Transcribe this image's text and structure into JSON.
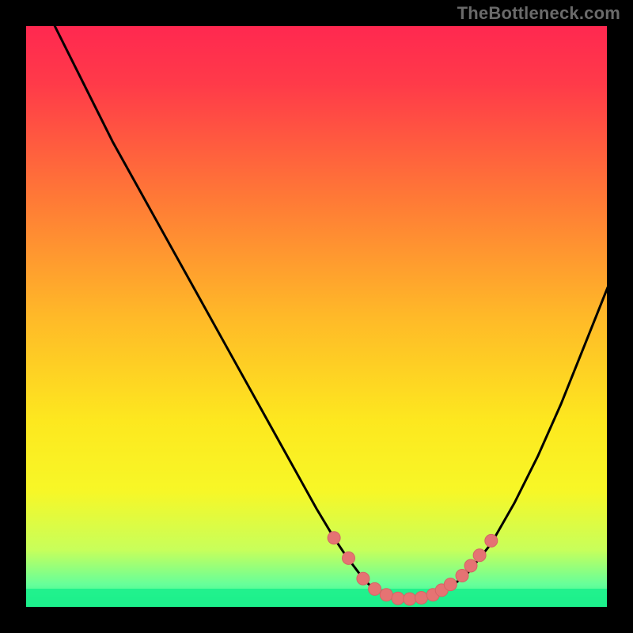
{
  "watermark": "TheBottleneck.com",
  "colors": {
    "background": "#000000",
    "gradient_stops": [
      {
        "offset": 0.0,
        "color": "#ff2850"
      },
      {
        "offset": 0.1,
        "color": "#ff3a49"
      },
      {
        "offset": 0.3,
        "color": "#ff7a36"
      },
      {
        "offset": 0.5,
        "color": "#ffb928"
      },
      {
        "offset": 0.68,
        "color": "#fde81f"
      },
      {
        "offset": 0.8,
        "color": "#f7f727"
      },
      {
        "offset": 0.9,
        "color": "#c8ff5a"
      },
      {
        "offset": 0.96,
        "color": "#66ff9a"
      },
      {
        "offset": 1.0,
        "color": "#1cf08c"
      }
    ],
    "curve": "#000000",
    "marker_fill": "#e57373",
    "marker_stroke": "#d46565"
  },
  "chart_data": {
    "type": "line",
    "title": "",
    "xlabel": "",
    "ylabel": "",
    "xlim": [
      0,
      100
    ],
    "ylim": [
      0,
      100
    ],
    "grid": false,
    "legend": false,
    "series": [
      {
        "name": "bottleneck-curve",
        "x": [
          5,
          10,
          15,
          20,
          25,
          30,
          35,
          40,
          45,
          50,
          53,
          55,
          58,
          60,
          63,
          65,
          68,
          70,
          73,
          76,
          80,
          84,
          88,
          92,
          96,
          100
        ],
        "values": [
          100,
          90,
          80,
          71,
          62,
          53,
          44,
          35,
          26,
          17,
          12,
          9,
          5,
          3,
          2,
          1.5,
          1.5,
          2,
          3.5,
          6,
          11,
          18,
          26,
          35,
          45,
          55
        ]
      }
    ],
    "markers": {
      "name": "highlight-points",
      "x": [
        53,
        55.5,
        58,
        60,
        62,
        64,
        66,
        68,
        70,
        71.5,
        73,
        75,
        76.5,
        78,
        80
      ],
      "values": [
        12,
        8.5,
        5,
        3.2,
        2.2,
        1.6,
        1.5,
        1.7,
        2.2,
        3,
        4,
        5.5,
        7.2,
        9,
        11.5
      ]
    }
  }
}
